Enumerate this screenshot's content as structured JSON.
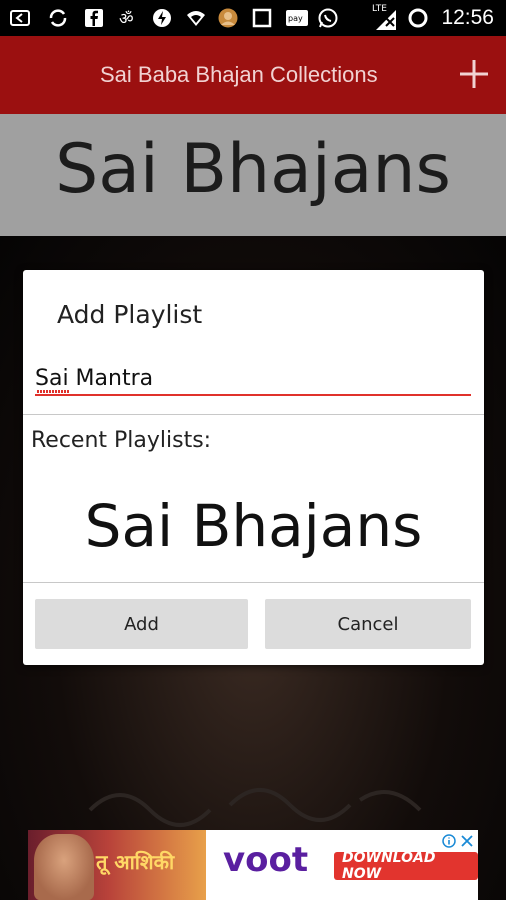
{
  "status_bar": {
    "time": "12:56",
    "network": "LTE",
    "icons": [
      "back-icon",
      "sync-icon",
      "facebook-icon",
      "om-icon",
      "bolt-icon",
      "wifi-icon",
      "avatar-icon",
      "stop-icon",
      "paytm-icon",
      "whatsapp-icon",
      "signal-icon",
      "alarm-icon"
    ]
  },
  "app_bar": {
    "title": "Sai Baba Bhajan Collections",
    "add_icon": "plus-icon"
  },
  "header": {
    "playlist_title": "Sai Bhajans"
  },
  "dialog": {
    "title": "Add Playlist",
    "input_value": "Sai Mantra",
    "recent_label": "Recent Playlists:",
    "recent_items": [
      "Sai Bhajans"
    ],
    "add_label": "Add",
    "cancel_label": "Cancel"
  },
  "ad": {
    "show_title": "तू आशिकी",
    "brand": "voot",
    "cta": "DOWNLOAD NOW",
    "info_icon": "info-icon",
    "close_icon": "close-icon"
  },
  "colors": {
    "app_bar": "#9b1010",
    "accent_underline": "#e0312b",
    "header_banner": "#a0a0a0",
    "button_bg": "#dcdcdc"
  }
}
